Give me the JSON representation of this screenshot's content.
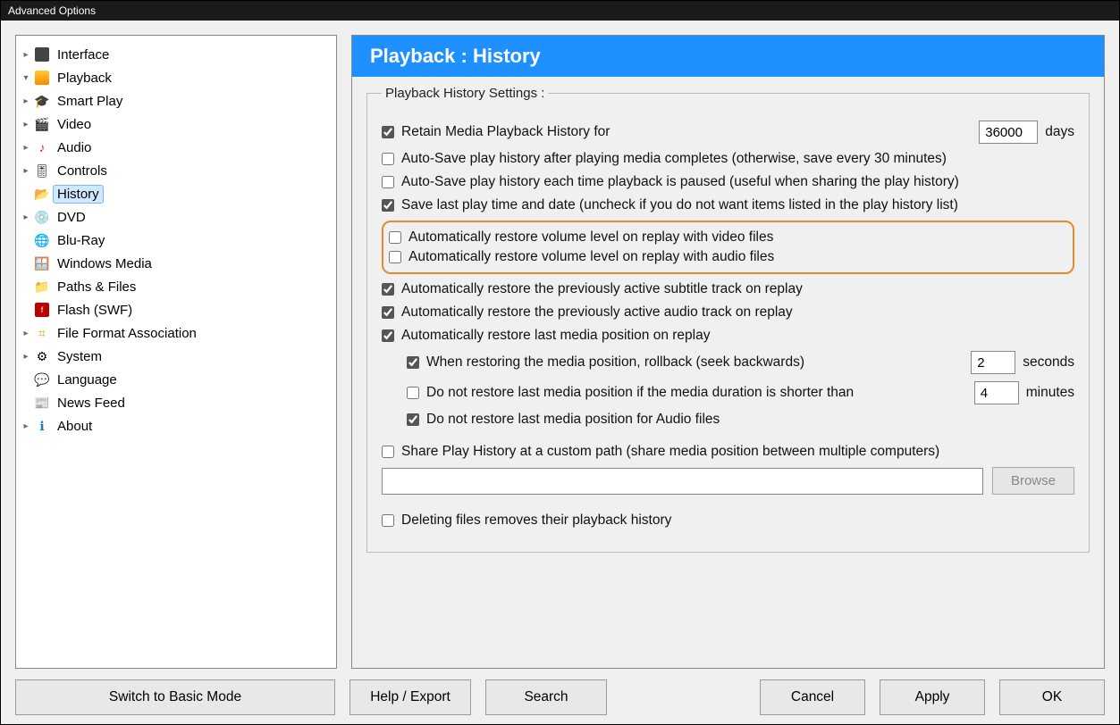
{
  "window": {
    "title": "Advanced Options"
  },
  "header": {
    "title": "Playback : History"
  },
  "legend": "Playback History Settings :",
  "tree": {
    "interface": "Interface",
    "playback": "Playback",
    "smart_play": "Smart Play",
    "video": "Video",
    "audio": "Audio",
    "controls": "Controls",
    "history": "History",
    "dvd": "DVD",
    "bluray": "Blu-Ray",
    "windows_media": "Windows Media",
    "paths_files": "Paths & Files",
    "flash": "Flash (SWF)",
    "file_format": "File Format Association",
    "system": "System",
    "language": "Language",
    "news_feed": "News Feed",
    "about": "About"
  },
  "settings": {
    "retain_label": "Retain Media Playback History for",
    "retain_value": "36000",
    "retain_unit": "days",
    "autosave_complete": "Auto-Save play history after playing media completes (otherwise, save every 30 minutes)",
    "autosave_pause": "Auto-Save play history each time playback is paused (useful when sharing the play history)",
    "save_last_time": "Save last play time and date (uncheck if you do not want items listed in the play history list)",
    "restore_vol_video": "Automatically restore volume level on replay with video files",
    "restore_vol_audio": "Automatically restore volume level on replay with audio files",
    "restore_subtitle": "Automatically restore the previously active subtitle track on replay",
    "restore_audio_track": "Automatically restore the previously active audio track on replay",
    "restore_position": "Automatically restore last media position on replay",
    "rollback_label": "When restoring the media position, rollback (seek backwards)",
    "rollback_value": "2",
    "rollback_unit": "seconds",
    "shorter_label": "Do not restore last media position if the media duration is shorter than",
    "shorter_value": "4",
    "shorter_unit": "minutes",
    "no_restore_audio": "Do not restore last media position for Audio files",
    "share_path": "Share Play History at a custom path (share media position between multiple computers)",
    "browse": "Browse",
    "delete_removes": "Deleting files removes their playback history"
  },
  "buttons": {
    "switch": "Switch to Basic Mode",
    "help": "Help / Export",
    "search": "Search",
    "cancel": "Cancel",
    "apply": "Apply",
    "ok": "OK"
  }
}
